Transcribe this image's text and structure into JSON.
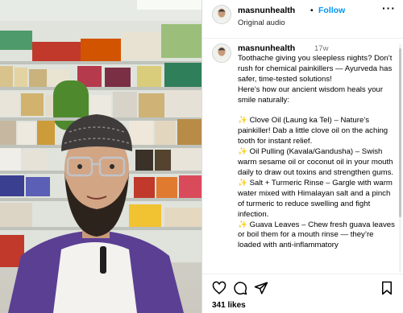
{
  "post": {
    "username": "masnunhealth",
    "separator": "•",
    "follow_label": "Follow",
    "audio_label": "Original audio",
    "more_label": "···"
  },
  "caption": {
    "username": "masnunhealth",
    "time": "17w",
    "text": "Toothache giving you sleepless nights? Don’t rush for chemical painkillers — Ayurveda has safer, time-tested solutions!\nHere’s how our ancient wisdom heals your smile naturally:\n\n✨ Clove Oil (Laung ka Tel) – Nature’s painkiller! Dab a little clove oil on the aching tooth for instant relief.\n✨ Oil Pulling (Kavala/Gandusha) – Swish warm sesame oil or coconut oil in your mouth daily to draw out toxins and strengthen gums.\n✨ Salt + Turmeric Rinse – Gargle with warm water mixed with Himalayan salt and a pinch of turmeric to reduce swelling and fight infection.\n✨ Guava Leaves – Chew fresh guava leaves or boil them for a mouth rinse — they’re loaded with anti-inflammatory"
  },
  "actions": {
    "likes_label": "341 likes"
  },
  "icons": {
    "like": "heart-icon",
    "comment": "comment-icon",
    "share": "share-icon",
    "save": "bookmark-icon"
  },
  "colors": {
    "follow": "#0095f6",
    "meta_gray": "#737373",
    "sparkle": "#f4c542"
  }
}
